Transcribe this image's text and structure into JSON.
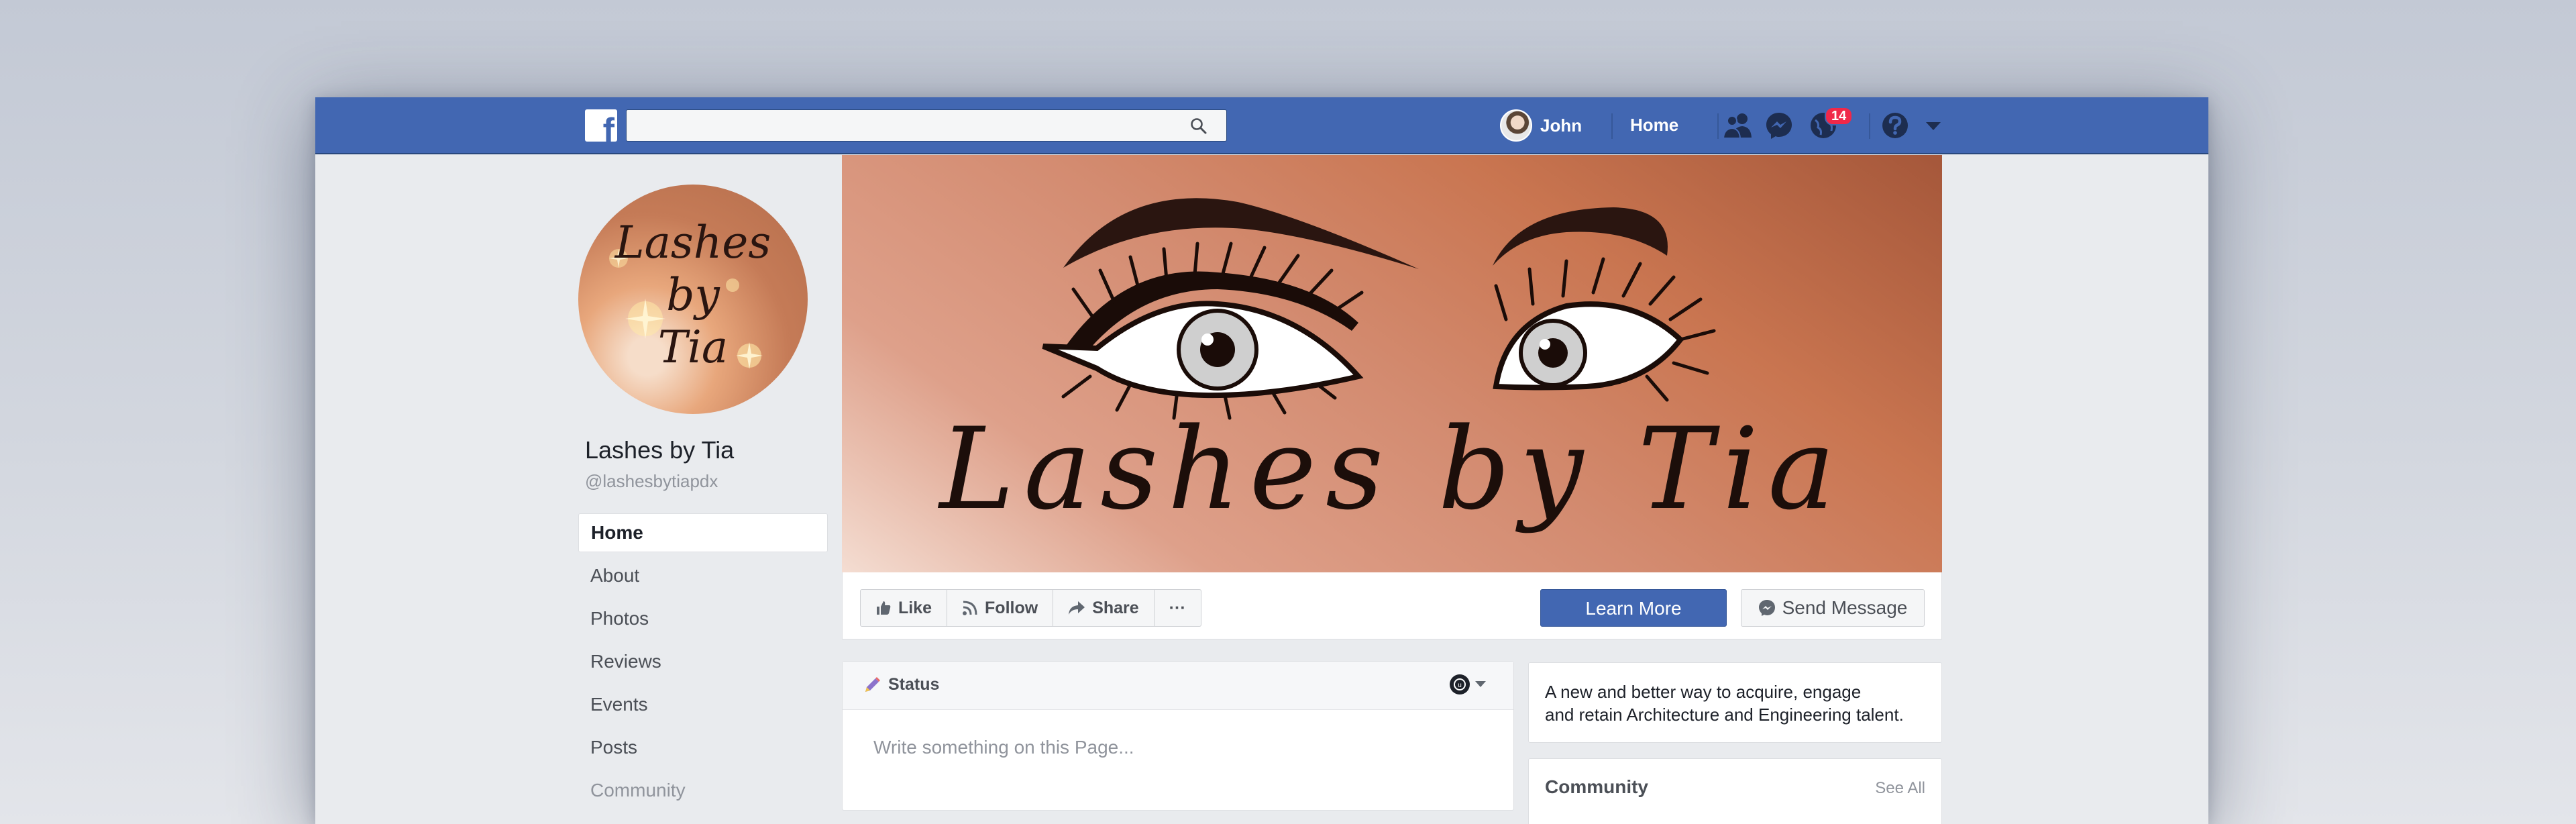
{
  "topbar": {
    "search_placeholder": "",
    "user_name": "John",
    "home_label": "Home",
    "notifications_count": "14"
  },
  "page": {
    "name": "Lashes by Tia",
    "handle": "@lashesbytiapdx",
    "profile_logo_lines": [
      "Lashes",
      "by",
      "Tia"
    ],
    "cover_title": "Lashes by Tia"
  },
  "left_nav": {
    "items": [
      "Home",
      "About",
      "Photos",
      "Reviews",
      "Events",
      "Posts",
      "Community"
    ]
  },
  "actions": {
    "like": "Like",
    "follow": "Follow",
    "share": "Share",
    "more": "···",
    "learn_more": "Learn More",
    "send_message": "Send Message"
  },
  "composer": {
    "tab": "Status",
    "placeholder": "Write something on this Page..."
  },
  "about_card": {
    "line1": "A new and better way to acquire, engage",
    "line2": "and retain Architecture and Engineering talent."
  },
  "community_card": {
    "title": "Community",
    "see_all": "See All"
  },
  "colors": {
    "brand_blue": "#4267b2",
    "badge_red": "#f02849",
    "page_bg": "#e9ebee"
  },
  "icons": [
    "facebook-logo-icon",
    "search-icon",
    "friends-icon",
    "messenger-icon",
    "globe-icon",
    "help-icon",
    "caret-down-icon",
    "like-icon",
    "follow-icon",
    "share-icon",
    "messenger-small-icon",
    "pencil-icon",
    "audience-icon"
  ]
}
